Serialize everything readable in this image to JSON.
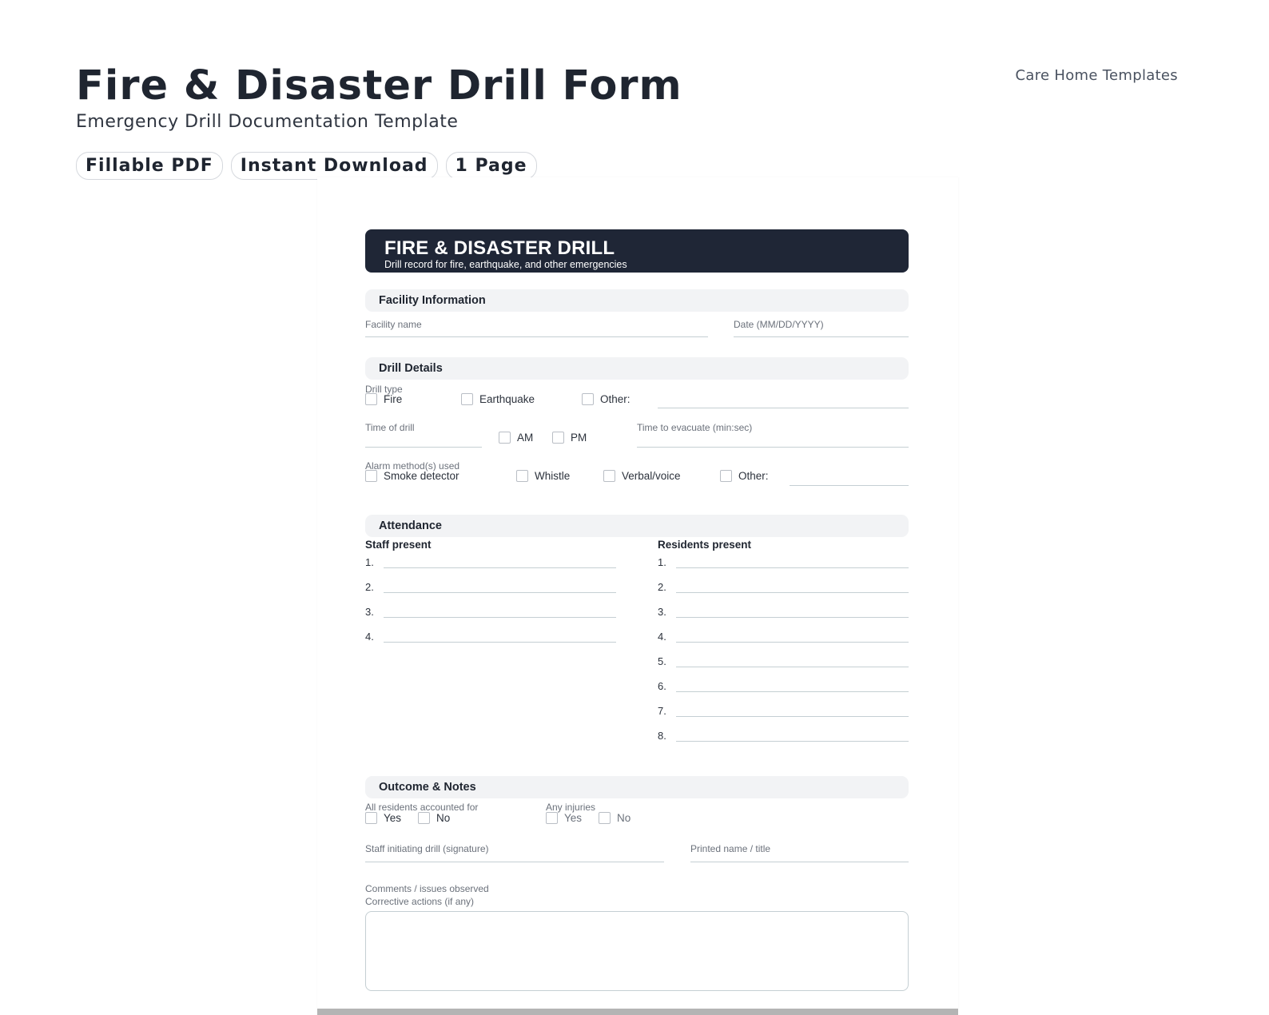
{
  "hero": {
    "title": "Fire & Disaster Drill Form",
    "subtitle": "Emergency Drill Documentation Template",
    "brand": "Care Home Templates",
    "badges": [
      "Fillable PDF",
      "Instant Download",
      "1 Page"
    ]
  },
  "form": {
    "header": {
      "title": "FIRE & DISASTER DRILL",
      "subtitle": "Drill record for fire, earthquake, and other emergencies"
    },
    "facility": {
      "heading": "Facility Information",
      "name_label": "Facility name",
      "date_label": "Date (MM/DD/YYYY)"
    },
    "drill": {
      "heading": "Drill Details",
      "type_label": "Drill type",
      "types": [
        "Fire",
        "Earthquake",
        "Other:"
      ],
      "time_label": "Time of drill",
      "ampm": [
        "AM",
        "PM"
      ],
      "evacuate_label": "Time to evacuate (min:sec)",
      "alarm_label": "Alarm method(s) used",
      "alarms": [
        "Smoke detector",
        "Whistle",
        "Verbal/voice",
        "Other:"
      ]
    },
    "attendance": {
      "heading": "Attendance",
      "staff_label": "Staff present",
      "residents_label": "Residents present",
      "staff_rows": [
        "1.",
        "2.",
        "3.",
        "4."
      ],
      "resident_rows": [
        "1.",
        "2.",
        "3.",
        "4.",
        "5.",
        "6.",
        "7.",
        "8."
      ]
    },
    "outcome": {
      "heading": "Outcome & Notes",
      "accounted_label": "All residents accounted for",
      "accounted_options": [
        "Yes",
        "No"
      ],
      "injuries_label": "Any injuries",
      "injuries_options": [
        "Yes",
        "No"
      ],
      "signature_label": "Staff initiating drill (signature)",
      "printed_label": "Printed name / title",
      "comments_label": "Comments / issues observed",
      "corrective_label": "Corrective actions (if any)"
    }
  }
}
